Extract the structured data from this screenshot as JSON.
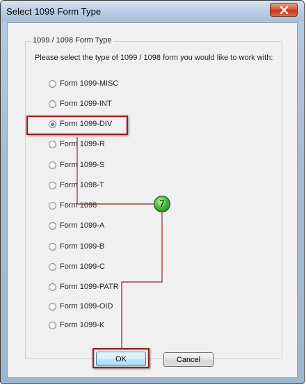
{
  "window": {
    "title": "Select 1099 Form Type"
  },
  "group": {
    "legend": "1099 / 1098 Form Type",
    "prompt": "Please select the type of 1099 / 1098 form you would like to work with:"
  },
  "options": [
    {
      "label": "Form 1099-MISC",
      "checked": false
    },
    {
      "label": "Form 1099-INT",
      "checked": false
    },
    {
      "label": "Form 1099-DIV",
      "checked": true
    },
    {
      "label": "Form 1099-R",
      "checked": false
    },
    {
      "label": "Form 1099-S",
      "checked": false
    },
    {
      "label": "Form 1098-T",
      "checked": false
    },
    {
      "label": "Form 1098",
      "checked": false
    },
    {
      "label": "Form 1099-A",
      "checked": false
    },
    {
      "label": "Form 1099-B",
      "checked": false
    },
    {
      "label": "Form 1099-C",
      "checked": false
    },
    {
      "label": "Form 1099-PATR",
      "checked": false
    },
    {
      "label": "Form 1099-OID",
      "checked": false
    },
    {
      "label": "Form 1099-K",
      "checked": false
    }
  ],
  "buttons": {
    "ok_label": "OK",
    "cancel_label": "Cancel"
  },
  "annotation": {
    "step_number": "7",
    "callout_color": "#9b1c25",
    "badge_color": "#3fb23a"
  }
}
